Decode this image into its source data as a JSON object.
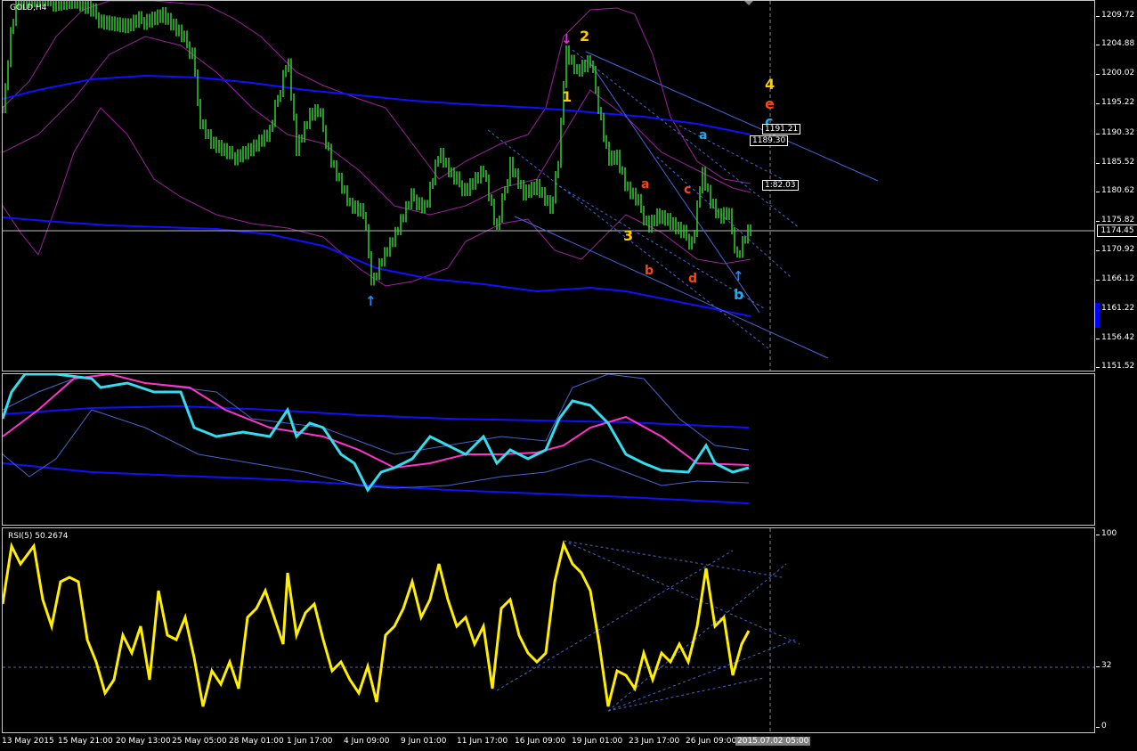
{
  "symbol": "GOLD,H4",
  "colors": {
    "bg": "#000000",
    "candle": "#33cc33",
    "ma": "#1010ff",
    "bands": "#a020a0",
    "cyan": "#33ddee",
    "magenta": "#ff33cc",
    "rsi": "#ffee00",
    "trend": "#4466dd",
    "wave_yellow": "#ffcc00",
    "wave_orange": "#ff4411",
    "wave_cyan": "#22aaee"
  },
  "main_axis": [
    "1209.72",
    "1204.88",
    "1200.02",
    "1195.22",
    "1190.32",
    "1185.52",
    "1180.62",
    "1175.82",
    "1170.92",
    "1166.12",
    "1161.22",
    "1156.42",
    "1151.52"
  ],
  "current_price": "1174.45",
  "levels": [
    "1191.21",
    "1189.30",
    "1:82.03"
  ],
  "wave_labels": {
    "w1": "1",
    "w2": "2",
    "w3": "3",
    "w4": "4",
    "a1": "a",
    "b1": "b",
    "c1": "c",
    "d1": "d",
    "e1": "e",
    "a2": "a",
    "b2": "b",
    "c2": "c"
  },
  "arrows": {
    "down": "↓",
    "up1": "↑",
    "up2": "↑"
  },
  "rsi": {
    "label": "RSI(5) 50.2674",
    "axis": [
      "100",
      "32",
      "0"
    ]
  },
  "xaxis": [
    "13 May 2015",
    "15 May 21:00",
    "20 May 13:00",
    "25 May 05:00",
    "28 May 01:00",
    "1 Jun 17:00",
    "4 Jun 09:00",
    "9 Jun 01:00",
    "11 Jun 17:00",
    "16 Jun 09:00",
    "19 Jun 01:00",
    "23 Jun 17:00",
    "26 Jun 09:00",
    "2015.07.02 05:00"
  ]
}
